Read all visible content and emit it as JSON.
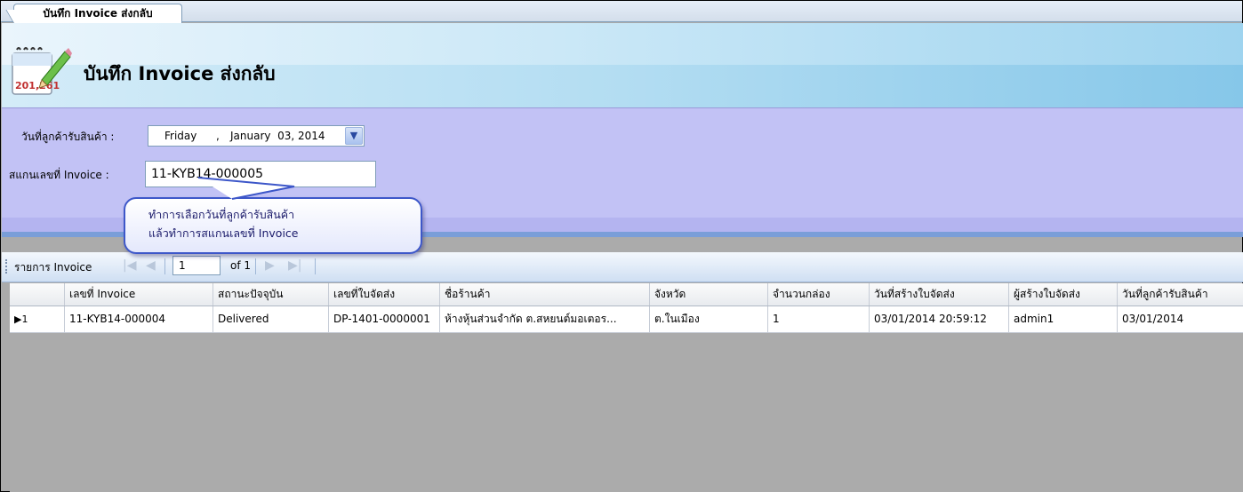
{
  "tab": {
    "label": "บันทึก Invoice ส่งกลับ"
  },
  "header": {
    "title": "บันทึก Invoice ส่งกลับ",
    "icon_number": "201,261"
  },
  "form": {
    "receive_date_label": "วันที่ลูกค้ารับสินค้า :",
    "receive_date": {
      "weekday": "Friday",
      "sep": ",",
      "month_day": "January  03, 2014"
    },
    "invoice_label": "สแกนเลขที่ Invoice :",
    "invoice_value": "11-KYB14-000005"
  },
  "tooltip": {
    "line1": "ทำการเลือกวันที่ลูกค้ารับสินค้า",
    "line2": "แล้วทำการสแกนเลขที่ Invoice"
  },
  "navigator": {
    "label": "รายการ Invoice",
    "position": "1",
    "of_total": "of 1"
  },
  "grid": {
    "columns": [
      "",
      "เลขที่ Invoice",
      "สถานะปัจจุบัน",
      "เลขที่ใบจัดส่ง",
      "ชื่อร้านค้า",
      "จังหวัด",
      "จำนวนกล่อง",
      "วันที่สร้างใบจัดส่ง",
      "ผู้สร้างใบจัดส่ง",
      "วันที่ลูกค้ารับสินค้า"
    ],
    "rows": [
      {
        "marker": "▶1",
        "cells": [
          "11-KYB14-000004",
          "Delivered",
          "DP-1401-0000001",
          "ห้างหุ้นส่วนจำกัด ต.สหยนต์มอเตอร...",
          "ต.ในเมือง",
          "1",
          "03/01/2014 20:59:12",
          "admin1",
          "03/01/2014"
        ]
      }
    ]
  },
  "colors": {
    "form_bg": "#c2c2f5",
    "balloon_border": "#3d57c9",
    "header_gradient_end": "#9fd4ef"
  }
}
